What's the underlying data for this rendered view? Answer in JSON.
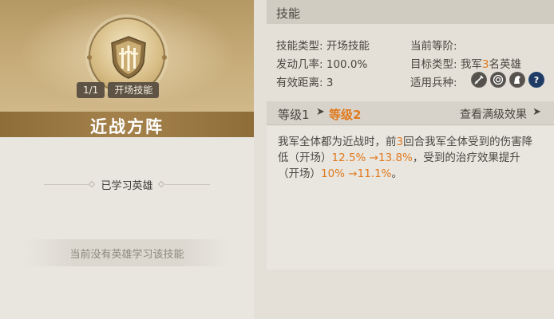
{
  "skill": {
    "name": "近战方阵",
    "level_badge": "1/1",
    "type_badge": "开场技能"
  },
  "left": {
    "learned_heroes_label": "已学习英雄",
    "empty_text": "当前没有英雄学习该技能"
  },
  "right": {
    "header": "技能",
    "info": {
      "type_label": "技能类型:",
      "type_value": "开场技能",
      "rate_label": "发动几率:",
      "rate_value": "100.0%",
      "range_label": "有效距离:",
      "range_value": "3",
      "rank_label": "当前等阶:",
      "rank_value": "",
      "target_label": "目标类型:",
      "target_prefix": "我军",
      "target_count": "3",
      "target_suffix": "名英雄",
      "troop_label": "适用兵种:"
    },
    "troop_icons": [
      "sword-icon",
      "target-icon",
      "horse-icon",
      "question-icon"
    ],
    "level": {
      "from": "等级1",
      "arrow": "➤",
      "to": "等级2",
      "view_full": "查看满级效果",
      "view_arrow": "➤"
    },
    "desc": {
      "p1": "我军全体都为近战时，前",
      "turns": "3",
      "p2": "回合我军全体受到的伤害降低（开场）",
      "v1": "12.5% →13.8%",
      "p3": "，受到的治疗效果提升（开场）",
      "v2": "10% →11.1%",
      "p4": "。"
    }
  },
  "colors": {
    "accent_orange": "#e07a1f",
    "title_bar": "#a3804a"
  }
}
